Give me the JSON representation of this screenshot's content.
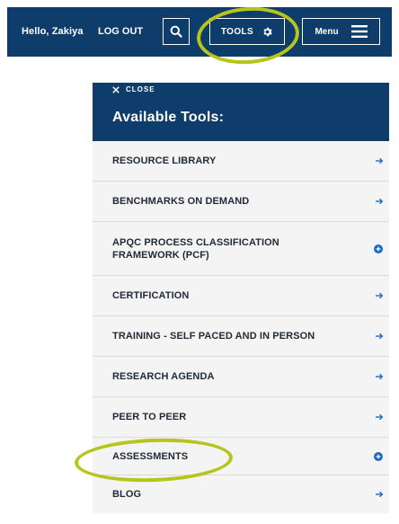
{
  "header": {
    "greeting": "Hello, Zakiya",
    "logout_label": "LOG OUT",
    "search_icon": "search-icon",
    "tools_label": "TOOLS",
    "tools_icon": "gear-icon",
    "menu_label": "Menu",
    "menu_icon": "hamburger-icon",
    "background_color": "#0e3d6b"
  },
  "tools_panel": {
    "close_label": "CLOSE",
    "close_icon": "close-icon",
    "title": "Available Tools:",
    "items": [
      {
        "label": "RESOURCE LIBRARY",
        "indicator": "arrow"
      },
      {
        "label": "BENCHMARKS ON DEMAND",
        "indicator": "arrow"
      },
      {
        "label": "APQC PROCESS CLASSIFICATION FRAMEWORK (PCF)",
        "indicator": "expand"
      },
      {
        "label": "CERTIFICATION",
        "indicator": "arrow"
      },
      {
        "label": "TRAINING - SELF PACED AND IN PERSON",
        "indicator": "arrow"
      },
      {
        "label": "RESEARCH AGENDA",
        "indicator": "arrow"
      },
      {
        "label": "PEER TO PEER",
        "indicator": "arrow"
      },
      {
        "label": "ASSESSMENTS",
        "indicator": "expand"
      },
      {
        "label": "BLOG",
        "indicator": "arrow"
      }
    ],
    "accent_color": "#1a6cc4",
    "list_background": "#f4f4f5"
  },
  "annotations": {
    "highlight_color": "#b6c51a"
  }
}
